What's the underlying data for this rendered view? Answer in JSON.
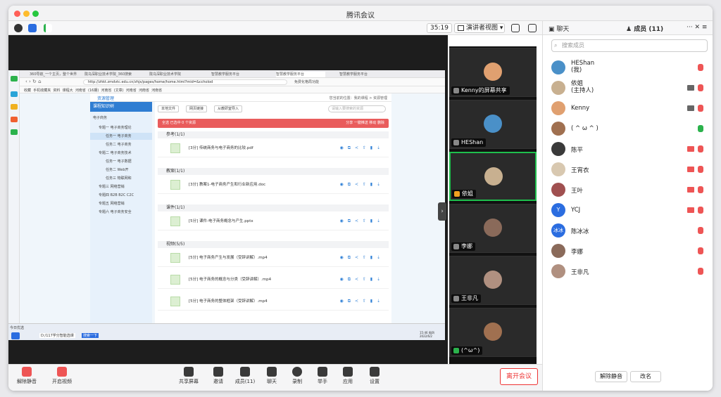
{
  "window": {
    "title": "腾讯会议"
  },
  "toolbar": {
    "timer": "35:19",
    "view_label": "演讲者视图"
  },
  "browser": {
    "tabs": [
      "360导航_一个主页，整个世界",
      "陇乌深职业技术学院_360搜索",
      "陇乌深职业技术学院",
      "智慧教学服务平台",
      "智慧教学服务平台",
      "智慧教学服务平台"
    ],
    "url": "http://zhkt.zmdvtc.edu.cn/zhjx/pages/home/home.html?mid=&ccholod",
    "address_right": "免费化格局功能",
    "bookmarks": [
      "收藏",
      "手机收藏夹",
      "资料",
      "课程大",
      "河南省",
      "(16期)",
      "河南省",
      "(文章)",
      "河南省",
      "河南省",
      "河南省"
    ]
  },
  "course": {
    "header": "资源管理",
    "crumb": "您当前的位置：我的课程 > 资源管理",
    "tree_header": "课程知识树",
    "tree": [
      "电子商务",
      "专题一 电子商务理论",
      "任务一 电子商务",
      "任务二 电子商务",
      "专题二 电子商务技术",
      "任务一 电子数据",
      "任务二 Web开",
      "任务三 物联网和",
      "专题三 网络营销",
      "专题四 B2B B2C C2C",
      "专题五 网络营销",
      "专题六 电子商务安全"
    ],
    "buttons": [
      "本地文件",
      "网页链接",
      "从教研室导入"
    ],
    "search_placeholder": "请输入要搜索的资源",
    "redbar": "全选  已选中 0 个资源",
    "redbar_actions": "分享  一键推送  移动  删除",
    "sections": [
      {
        "title": "参考(1/1)",
        "files": [
          "[3分]  传统商务与电子商务的比较.pdf"
        ]
      },
      {
        "title": "教案(1/1)",
        "files": [
          "[3分]  教案1-电子商务产生和行业新应用.doc"
        ]
      },
      {
        "title": "课件(1/1)",
        "files": [
          "[5分]  课件-电子商务概念与产生.pptx"
        ]
      },
      {
        "title": "视频(5/5)",
        "files": [
          "[5分]  电子商务产生与发展（受辞讲解）.mp4",
          "[5分]  电子商务的概念与分类（受辞讲解）.mp4",
          "[5分]  电子商务的整体框架（受辞讲解）.mp4"
        ]
      }
    ],
    "file_actions": "◉ ⧉ ≺ ⇧ ▮ ⇣",
    "taskbar_start": "今日优选",
    "taskbar_items": [
      "D:/117学分智能选课",
      "搜索一下"
    ],
    "clock": "15:46 周四\n2022/6/2"
  },
  "tiles": [
    {
      "name": "Kenny的屏幕共享",
      "color": "#e0a070"
    },
    {
      "name": "HEShan",
      "color": "#4a90c8"
    },
    {
      "name": "依姐",
      "color": "#c8b090",
      "active": true
    },
    {
      "name": "李娜",
      "color": "#8a6a5a"
    },
    {
      "name": "王非凡",
      "color": "#b09080"
    },
    {
      "name": "(^ω^)",
      "color": "#a07050"
    }
  ],
  "panel": {
    "tab_chat": "聊天",
    "tab_members": "成员 (11)",
    "search_placeholder": "搜索成员",
    "members": [
      {
        "name": "HEShan",
        "sub": "(我)",
        "color": "#4a90c8"
      },
      {
        "name": "依姐",
        "sub": "(主持人)",
        "color": "#c8b090"
      },
      {
        "name": "Kenny",
        "sub": "",
        "color": "#e0a070"
      },
      {
        "name": "( ^ ω ^ )",
        "sub": "",
        "color": "#a07050"
      },
      {
        "name": "陈平",
        "sub": "",
        "color": "#3a3a3a"
      },
      {
        "name": "王宵衣",
        "sub": "",
        "color": "#d8c8b0"
      },
      {
        "name": "王叶",
        "sub": "",
        "color": "#a05050"
      },
      {
        "name": "YCJ",
        "sub": "",
        "color": "#2b6de0",
        "initial": "Y"
      },
      {
        "name": "陈冰冰",
        "sub": "",
        "color": "#2b6de0",
        "initial": "冰冰"
      },
      {
        "name": "李娜",
        "sub": "",
        "color": "#8a6a5a"
      },
      {
        "name": "王非凡",
        "sub": "",
        "color": "#b09080"
      }
    ],
    "btn_mute_all": "解除静音",
    "btn_rename": "改名"
  },
  "bottom": {
    "unmute": "解除静音",
    "video": "开启视频",
    "share": "共享屏幕",
    "invite": "邀请",
    "members": "成员(11)",
    "chat": "聊天",
    "record": "录制",
    "raise": "举手",
    "apps": "应用",
    "settings": "设置",
    "leave": "离开会议"
  }
}
